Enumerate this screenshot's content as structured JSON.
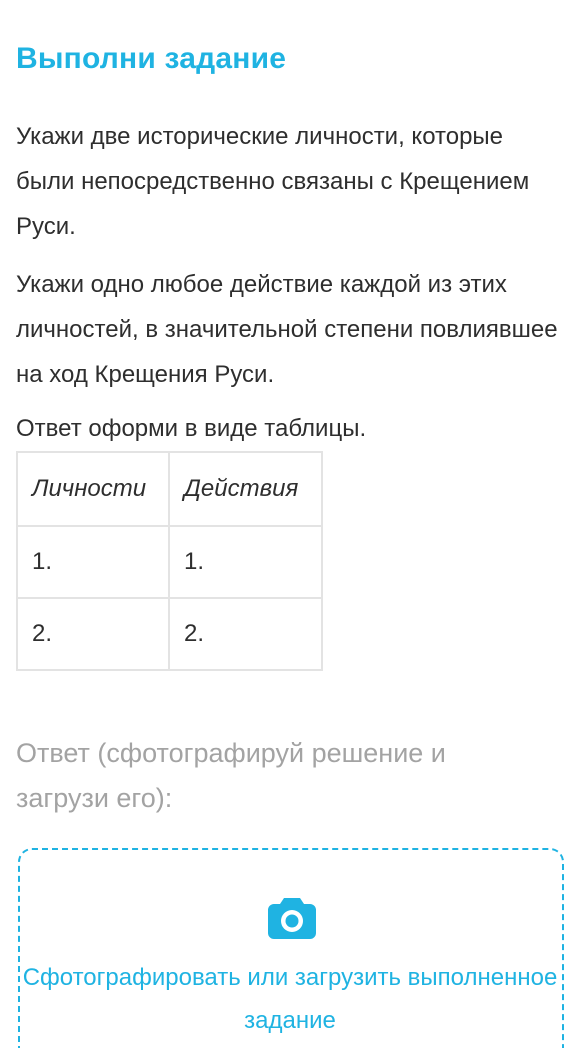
{
  "task": {
    "title": "Выполни задание",
    "paragraph1": "Укажи две исторические личности, которые были непосредственно связаны с Крещением Руси.",
    "paragraph2": "Укажи одно любое действие каждой из этих личностей, в значительной степени повлиявшее на ход Крещения Руси.",
    "paragraph3": "Ответ оформи в виде таблицы."
  },
  "table": {
    "headers": [
      "Личности",
      "Действия"
    ],
    "rows": [
      [
        "1.",
        "1."
      ],
      [
        "2.",
        "2."
      ]
    ]
  },
  "answer": {
    "prompt": "Ответ (сфотографируй решение и загрузи его):",
    "upload_label": "Сфотографировать или загрузить выполненное задание",
    "icon": "camera-icon"
  },
  "colors": {
    "accent": "#1fb3e2",
    "text": "#2e2e2e",
    "muted": "#a3a3a3",
    "table_border": "#e3e3e3"
  }
}
